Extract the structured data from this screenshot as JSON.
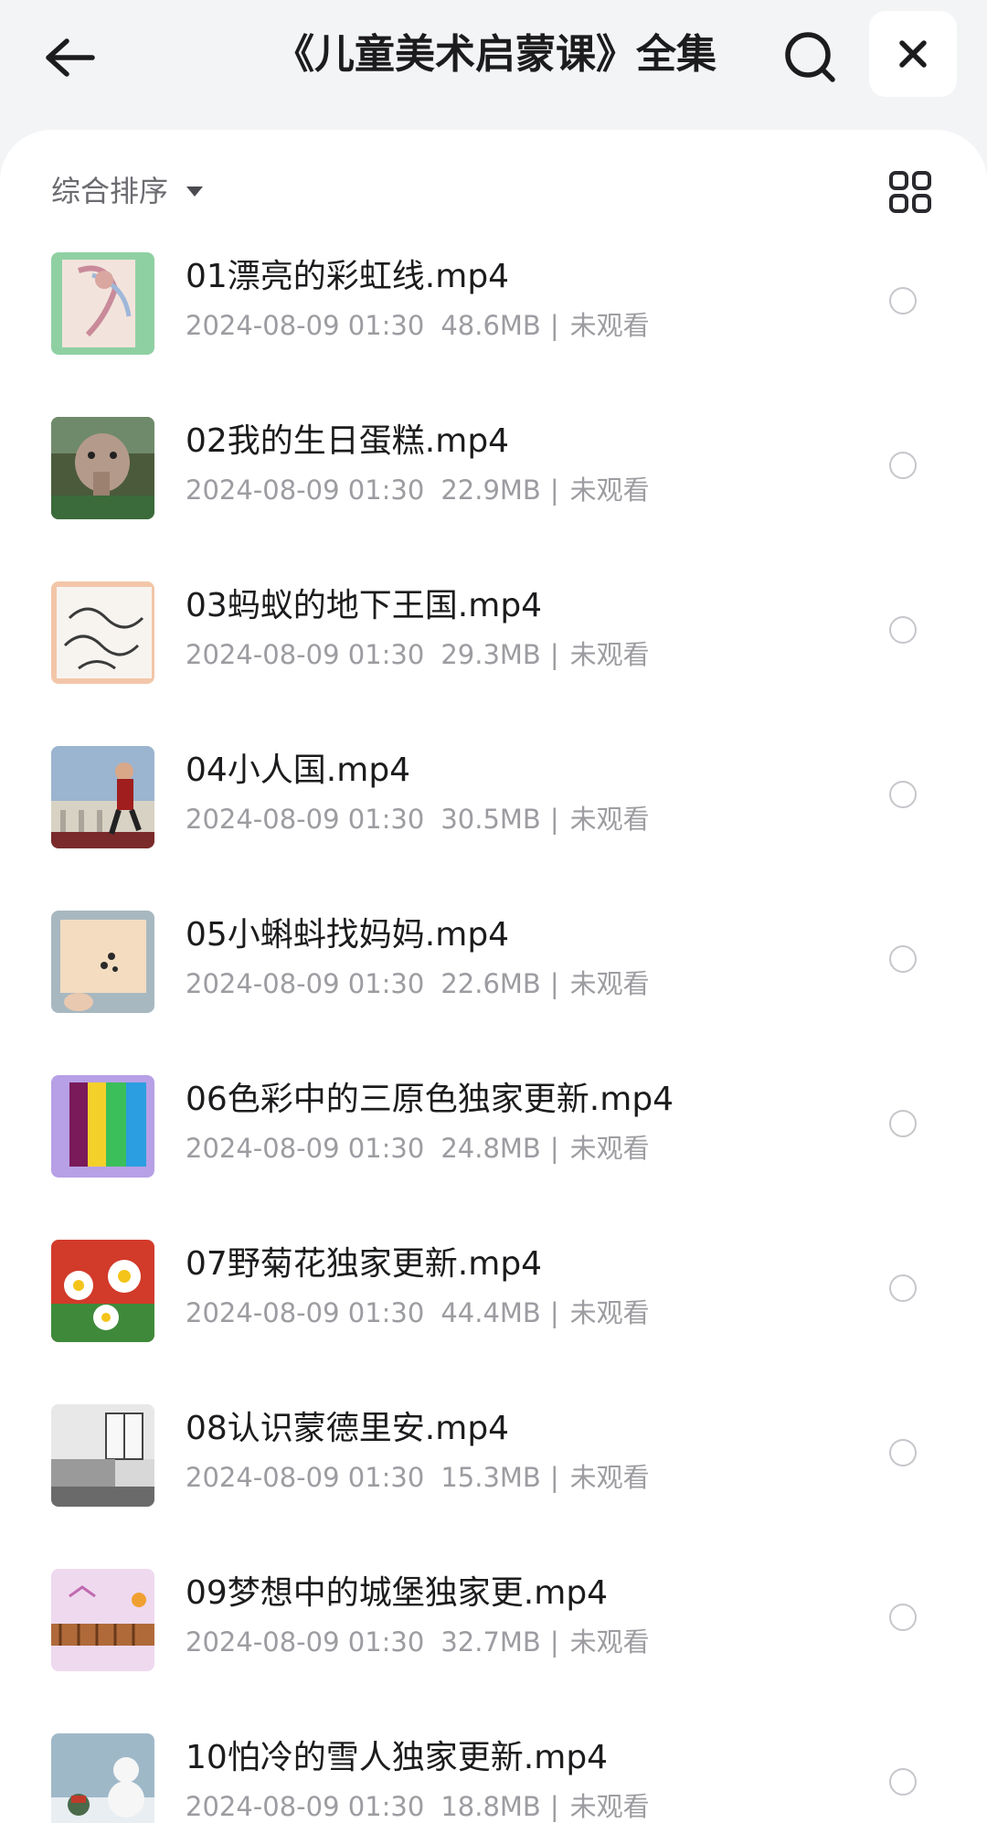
{
  "header": {
    "title": "《儿童美术启蒙课》全集",
    "back_icon": "arrow-left-icon",
    "search_icon": "search-icon",
    "close_icon": "close-icon"
  },
  "toolbar": {
    "sort_label": "综合排序",
    "sort_icon": "caret-down-icon",
    "view_icon": "grid-view-icon"
  },
  "files": [
    {
      "name": "01漂亮的彩虹线.mp4",
      "date": "2024-08-09 01:30",
      "size": "48.6MB",
      "status": "未观看"
    },
    {
      "name": "02我的生日蛋糕.mp4",
      "date": "2024-08-09 01:30",
      "size": "22.9MB",
      "status": "未观看"
    },
    {
      "name": "03蚂蚁的地下王国.mp4",
      "date": "2024-08-09 01:30",
      "size": "29.3MB",
      "status": "未观看"
    },
    {
      "name": "04小人国.mp4",
      "date": "2024-08-09 01:30",
      "size": "30.5MB",
      "status": "未观看"
    },
    {
      "name": "05小蝌蚪找妈妈.mp4",
      "date": "2024-08-09 01:30",
      "size": "22.6MB",
      "status": "未观看"
    },
    {
      "name": "06色彩中的三原色独家更新.mp4",
      "date": "2024-08-09 01:30",
      "size": "24.8MB",
      "status": "未观看"
    },
    {
      "name": "07野菊花独家更新.mp4",
      "date": "2024-08-09 01:30",
      "size": "44.4MB",
      "status": "未观看"
    },
    {
      "name": "08认识蒙德里安.mp4",
      "date": "2024-08-09 01:30",
      "size": "15.3MB",
      "status": "未观看"
    },
    {
      "name": "09梦想中的城堡独家更.mp4",
      "date": "2024-08-09 01:30",
      "size": "32.7MB",
      "status": "未观看"
    },
    {
      "name": "10怕冷的雪人独家更新.mp4",
      "date": "2024-08-09 01:30",
      "size": "18.8MB",
      "status": "未观看"
    }
  ],
  "meta_separator": "|"
}
